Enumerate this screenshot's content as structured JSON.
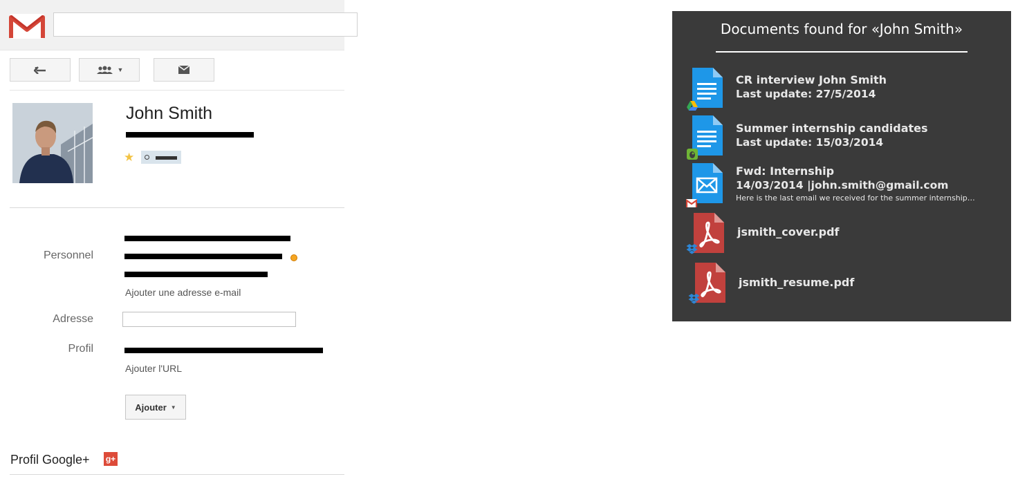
{
  "contact": {
    "name": "John Smith"
  },
  "fields": {
    "personnel_label": "Personnel",
    "add_email_link": "Ajouter une adresse e-mail",
    "address_label": "Adresse",
    "address_value": "",
    "profile_label": "Profil",
    "add_url_link": "Ajouter l'URL",
    "add_button_label": "Ajouter"
  },
  "gplus": {
    "label": "Profil Google+",
    "icon_text": "g+"
  },
  "panel": {
    "title": "Documents found for «John Smith»",
    "documents": [
      {
        "type": "doc",
        "source": "drive-icon",
        "title": "CR interview John Smith",
        "meta": "Last update: 27/5/2014"
      },
      {
        "type": "doc",
        "source": "evernote-icon",
        "title": "Summer internship candidates",
        "meta": "Last update: 15/03/2014"
      },
      {
        "type": "email",
        "source": "gmail-icon",
        "title": "Fwd: Internship",
        "meta": "14/03/2014 |john.smith@gmail.com",
        "snippet": "Here is the last email we received for the summer internship…"
      },
      {
        "type": "pdf",
        "source": "dropbox-icon",
        "title": "jsmith_cover.pdf"
      },
      {
        "type": "pdf",
        "source": "dropbox-icon",
        "title": "jsmith_resume.pdf"
      }
    ]
  },
  "colors": {
    "panel_bg": "#3a3a3a",
    "doc_blue": "#1e97e8",
    "pdf_red": "#c1413d",
    "gmail_red": "#d44638",
    "star_yellow": "#f3c343"
  }
}
